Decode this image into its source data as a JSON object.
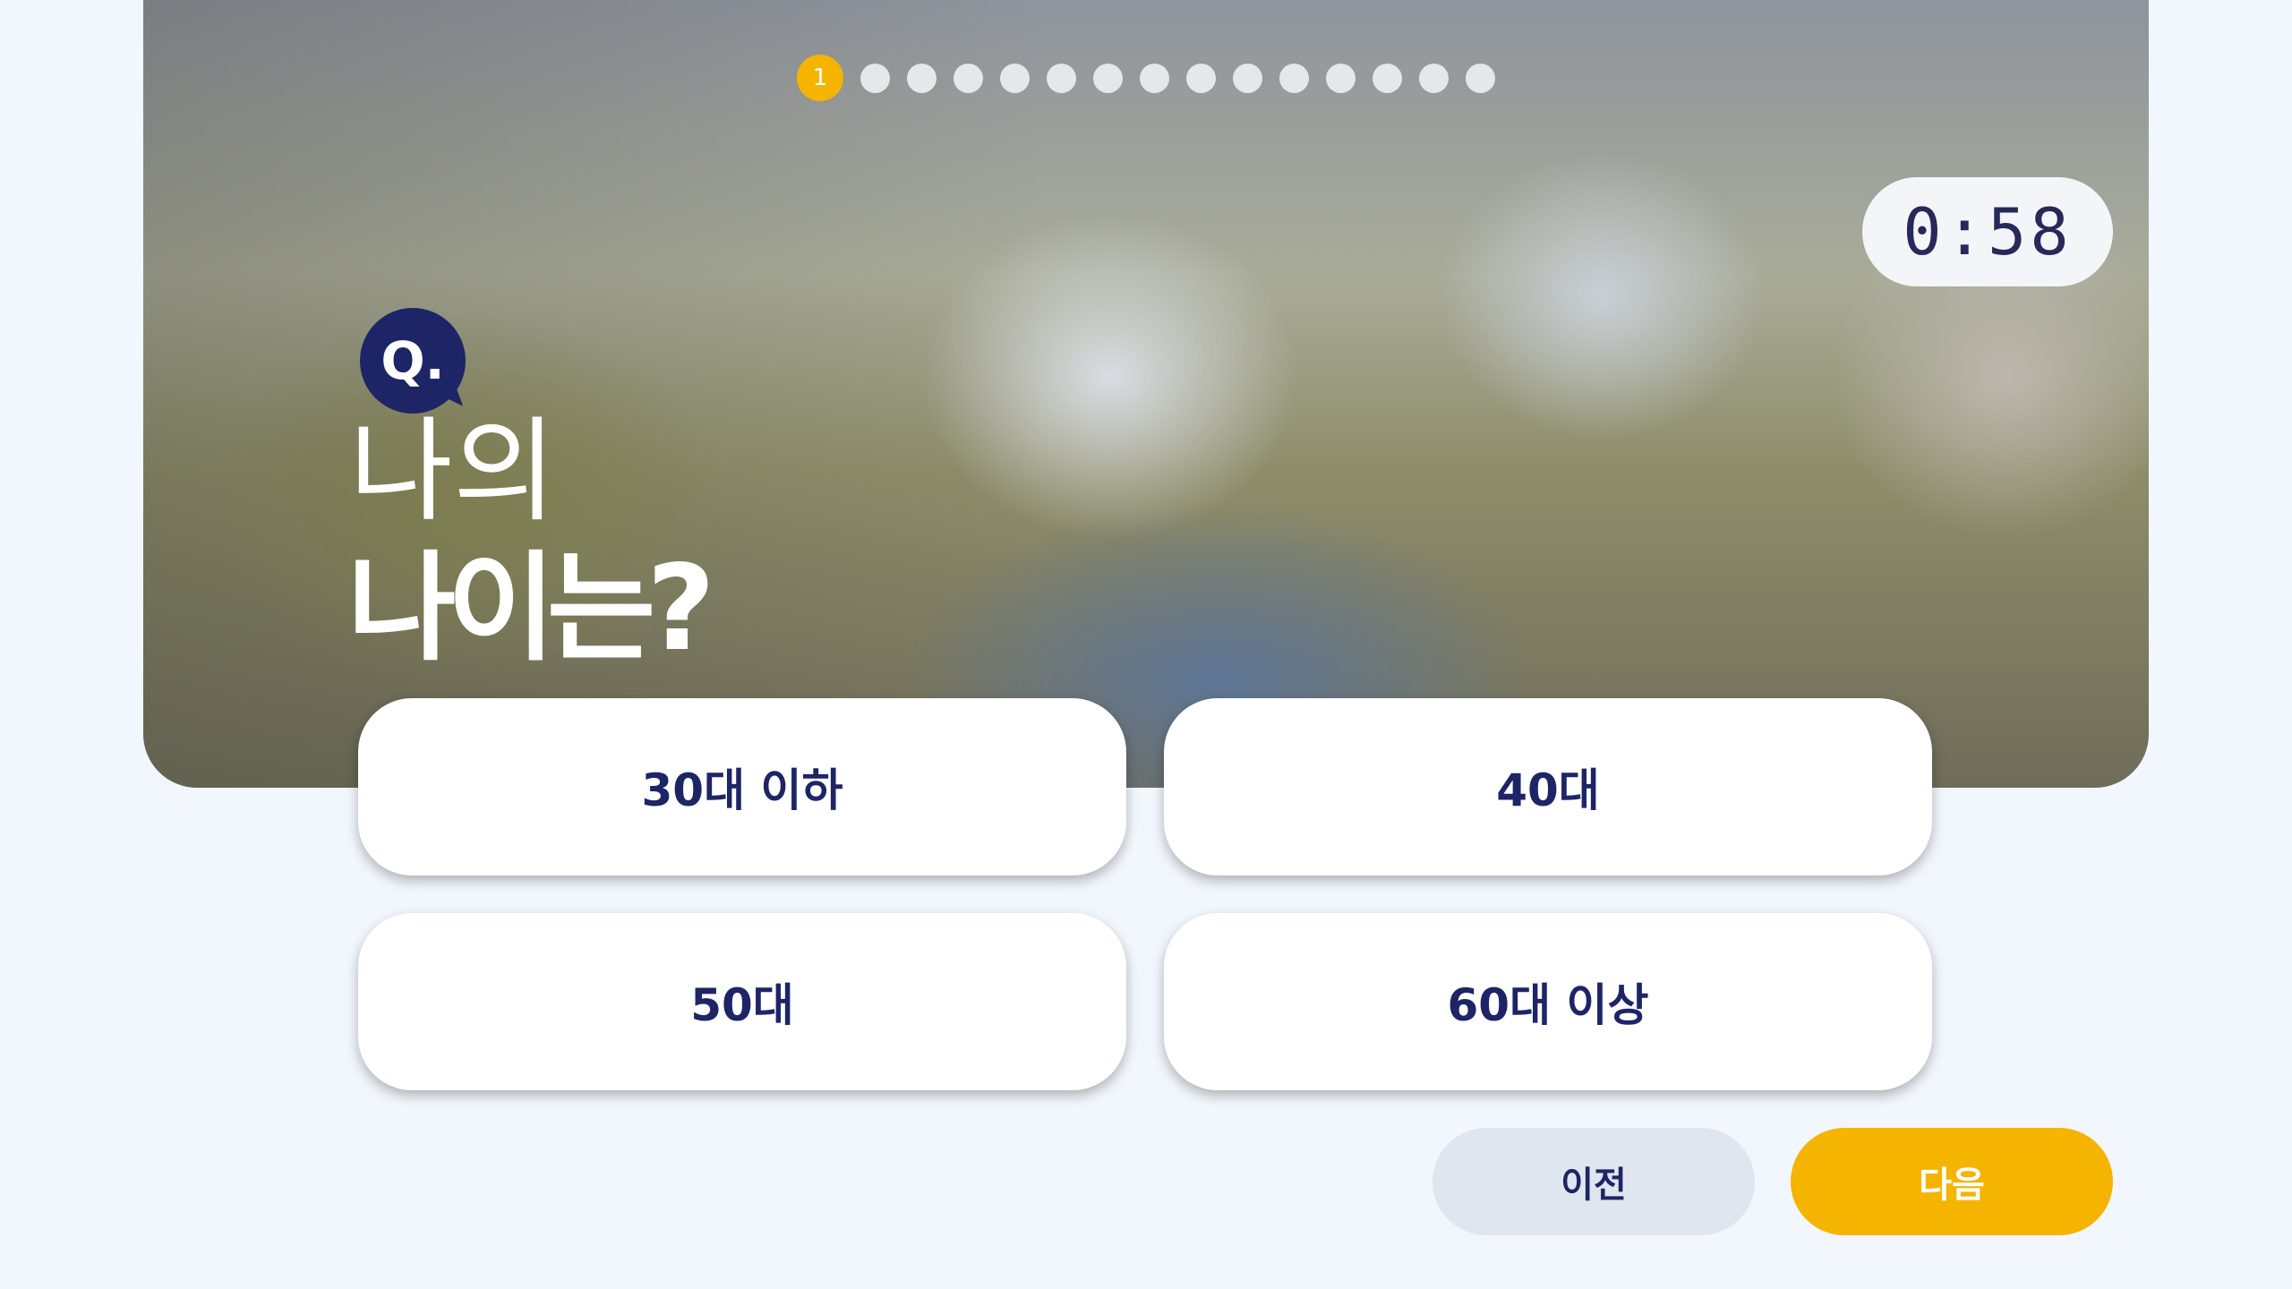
{
  "progress": {
    "current_step": 1,
    "total_steps": 15,
    "current_label": "1",
    "active_color": "#f5b400"
  },
  "timer": {
    "display": "0:58"
  },
  "question": {
    "badge": "Q.",
    "line1": "나의",
    "line2": "나이는?"
  },
  "answers": [
    {
      "label": "30대 이하"
    },
    {
      "label": "40대"
    },
    {
      "label": "50대"
    },
    {
      "label": "60대 이상"
    }
  ],
  "nav": {
    "prev_label": "이전",
    "next_label": "다음"
  },
  "colors": {
    "navy": "#1d2566",
    "accent": "#f5b400",
    "page_bg": "#f2f7fd"
  }
}
